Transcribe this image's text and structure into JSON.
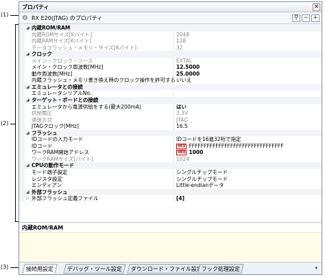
{
  "callouts": [
    "(1)",
    "(2)",
    "(3)"
  ],
  "window": {
    "title": "プロパティ",
    "close_glyph": "×"
  },
  "toolbar": {
    "target": "RX E20(JTAG) のプロパティ",
    "search_glyph": "⚲",
    "collapse_glyph": "−",
    "expand_glyph": "+"
  },
  "rows": [
    {
      "type": "cat",
      "label": "内蔵ROM/RAM"
    },
    {
      "type": "prop",
      "name": "内蔵ROMサイズ[Kバイト]",
      "value": "2048",
      "ro": true
    },
    {
      "type": "prop",
      "name": "内蔵RAMサイズ[Kバイト]",
      "value": "128",
      "ro": true
    },
    {
      "type": "prop",
      "name": "データフラッシュ・メモリ・サイズ[Kバイト]",
      "value": "32",
      "ro": true
    },
    {
      "type": "cat",
      "label": "クロック"
    },
    {
      "type": "prop",
      "name": "メイン・クロック・ソース",
      "value": "EXTAL",
      "ro": true
    },
    {
      "type": "prop",
      "name": "メイン・クロック周波数[MHz]",
      "value": "12.5000",
      "bold": true
    },
    {
      "type": "prop",
      "name": "動作周波数[MHz]",
      "value": "25.0000",
      "bold": true
    },
    {
      "type": "prop",
      "name": "内蔵フラッシュ・メモリ書き換え時のクロック操作を許可する",
      "value": "いいえ"
    },
    {
      "type": "cat",
      "label": "エミュレータとの接続"
    },
    {
      "type": "prop",
      "name": "エミュレータシリアルNo.",
      "value": ""
    },
    {
      "type": "cat",
      "label": "ターゲット・ボードとの接続"
    },
    {
      "type": "prop",
      "name": "エミュレータから電源供給をする(最大200mA)",
      "value": "はい",
      "bold": true
    },
    {
      "type": "prop",
      "name": "供給電圧",
      "value": "3.3V",
      "ro": true
    },
    {
      "type": "prop",
      "name": "通信方式",
      "value": "JTAG",
      "ro": true
    },
    {
      "type": "prop",
      "name": "JTAGクロック[MHz]",
      "value": "16.5"
    },
    {
      "type": "cat",
      "label": "フラッシュ"
    },
    {
      "type": "prop",
      "name": "IDコードの入力モード",
      "value": "IDコードを16進32桁で指定"
    },
    {
      "type": "prop",
      "name": "IDコード",
      "value": "FFFFFFFFFFFFFFFFFFFFFFFFFFFFFFFF",
      "hex": "HEX"
    },
    {
      "type": "prop",
      "name": "ワークRAM開始アドレス",
      "value": "1000",
      "hex": "HEX",
      "bold": true
    },
    {
      "type": "prop",
      "name": "ワークRAMサイズ[バイト]",
      "value": "1024",
      "ro": true
    },
    {
      "type": "cat",
      "label": "CPUの動作モード"
    },
    {
      "type": "prop",
      "name": "モード端子設定",
      "value": "シングルチップモード"
    },
    {
      "type": "prop",
      "name": "レジスタ設定",
      "value": "シングルチップモード"
    },
    {
      "type": "prop",
      "name": "エンディアン",
      "value": "Little-endianデータ"
    },
    {
      "type": "cat",
      "label": "外部フラッシュ"
    },
    {
      "type": "prop",
      "name": "外部フラッシュ定義ファイル",
      "value": "[4]",
      "bold": true,
      "expander": "▷"
    }
  ],
  "description": {
    "title": "内蔵ROM/RAM"
  },
  "tabs": [
    "接続用設定",
    "デバッグ・ツール設定",
    "ダウンロード・ファイル設定",
    "フック処理設定"
  ],
  "tab_menu_glyph": "▾",
  "colors": {
    "hex_badge": "#c00000",
    "description_bg": "#fffde8",
    "category_bg": "#f2f4f7"
  }
}
